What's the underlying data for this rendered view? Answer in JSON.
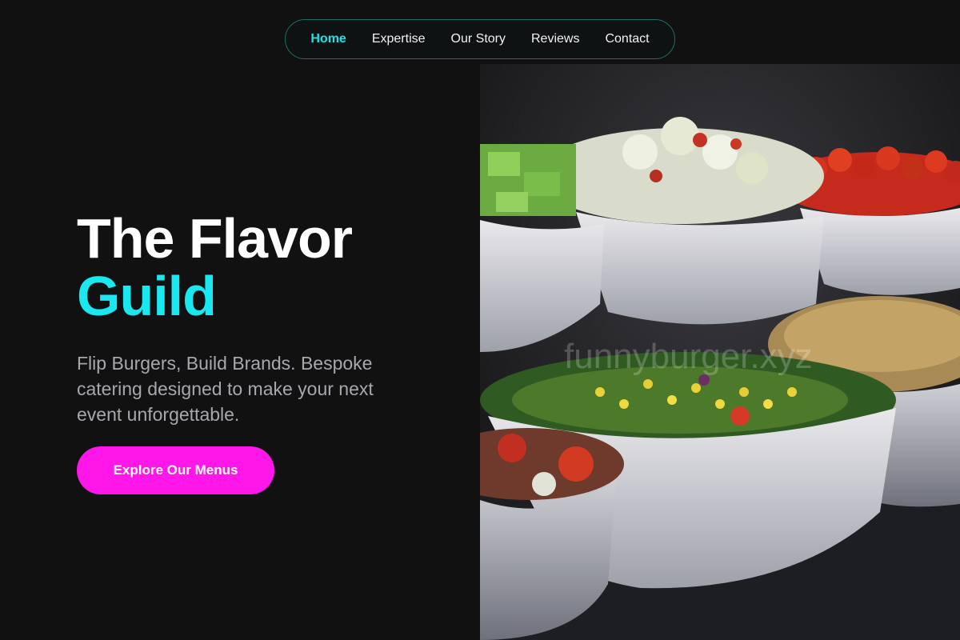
{
  "nav": {
    "items": [
      {
        "label": "Home",
        "active": true
      },
      {
        "label": "Expertise",
        "active": false
      },
      {
        "label": "Our Story",
        "active": false
      },
      {
        "label": "Reviews",
        "active": false
      },
      {
        "label": "Contact",
        "active": false
      }
    ]
  },
  "hero": {
    "title_line1": "The Flavor",
    "title_line2": "Guild",
    "subtitle": "Flip Burgers, Build Brands. Bespoke catering designed to make your next event unforgettable.",
    "cta_label": "Explore Our Menus",
    "image_alt": "Bowls of salads on a buffet table",
    "watermark": "funnyburger.xyz"
  },
  "colors": {
    "background": "#111112",
    "accent_cyan": "#19e8f0",
    "cta_magenta": "#ff16e8",
    "nav_border": "#1f6e6a"
  }
}
